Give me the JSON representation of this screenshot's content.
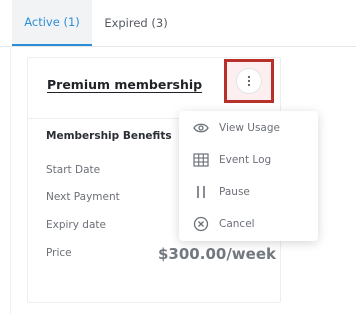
{
  "tabs": [
    {
      "label": "Active (1)"
    },
    {
      "label": "Expired (3)"
    }
  ],
  "card": {
    "title": "Premium membership",
    "section": "Membership Benefits",
    "rows": [
      {
        "label": "Start Date"
      },
      {
        "label": "Next Payment"
      },
      {
        "label": "Expiry date"
      },
      {
        "label": "Price"
      }
    ],
    "price": "$300.00/week"
  },
  "menu": {
    "items": [
      {
        "label": "View Usage",
        "icon": "eye-icon"
      },
      {
        "label": "Event Log",
        "icon": "grid-icon"
      },
      {
        "label": "Pause",
        "icon": "pause-icon"
      },
      {
        "label": "Cancel",
        "icon": "cancel-circle-icon"
      }
    ]
  },
  "colors": {
    "accent": "#2c8fd6",
    "highlight_border": "#b8302a"
  }
}
